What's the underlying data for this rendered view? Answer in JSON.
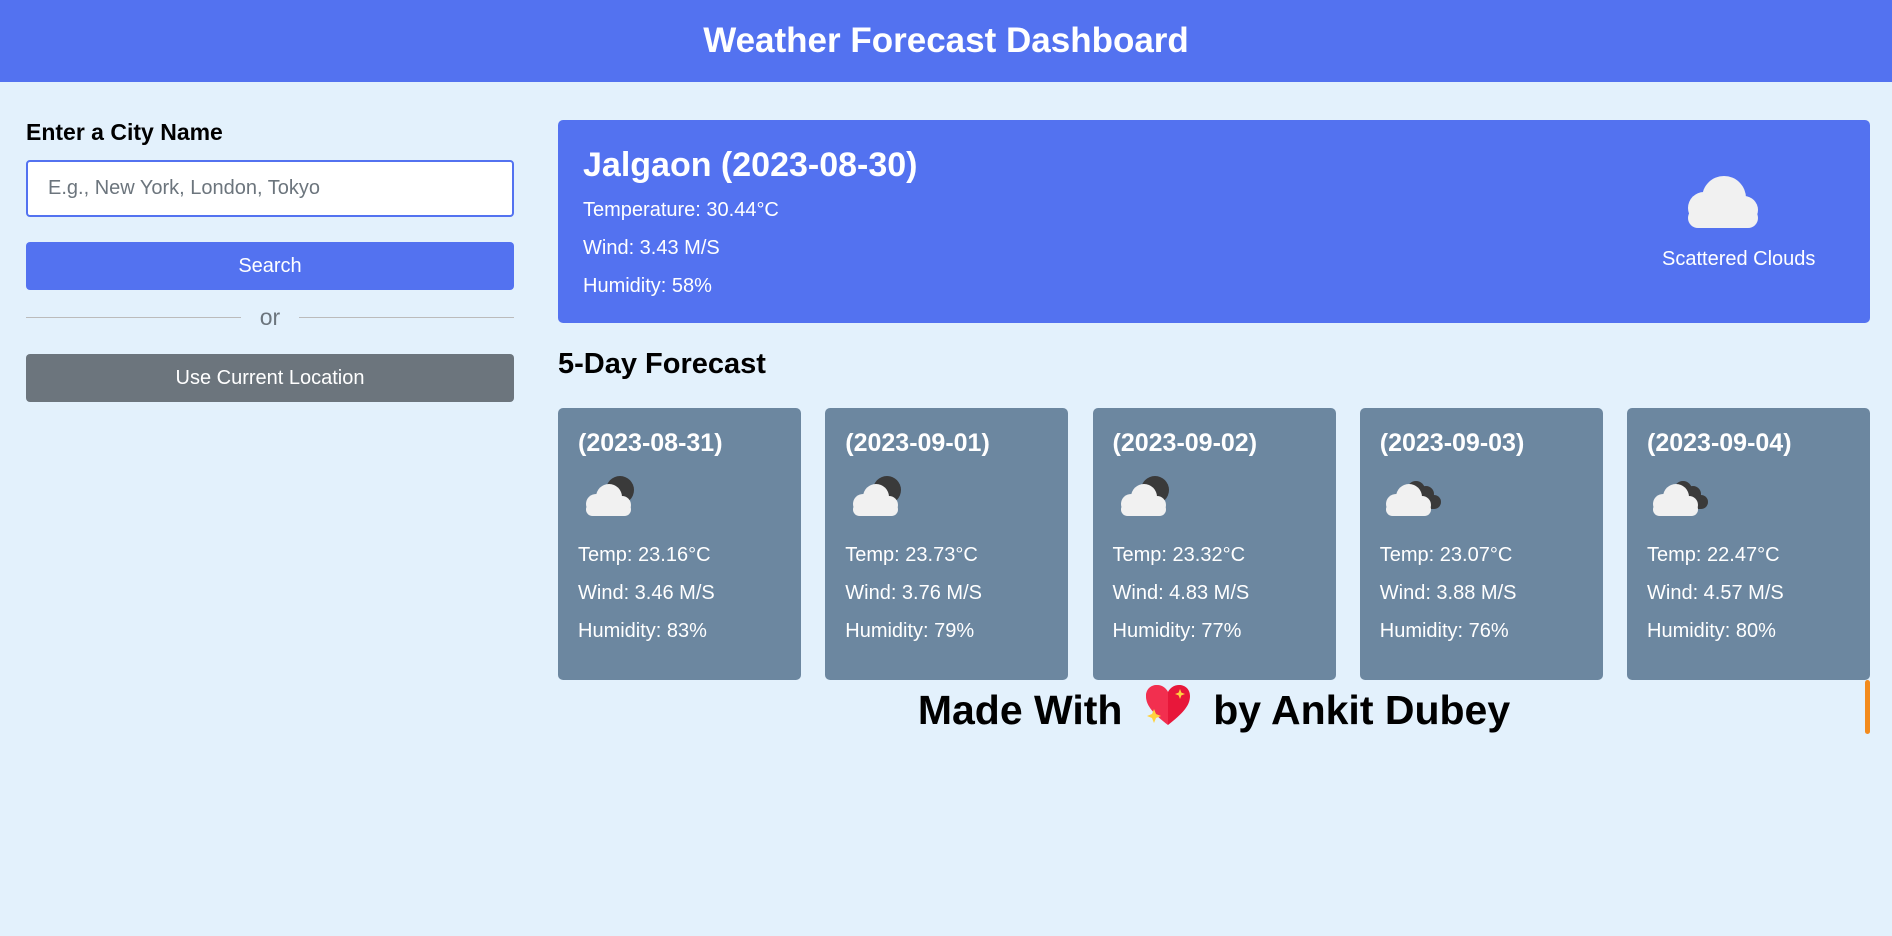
{
  "header": {
    "title": "Weather Forecast Dashboard"
  },
  "sidebar": {
    "label": "Enter a City Name",
    "input": {
      "value": "",
      "placeholder": "E.g., New York, London, Tokyo"
    },
    "search_label": "Search",
    "separator_text": "or",
    "location_label": "Use Current Location"
  },
  "current": {
    "title": "Jalgaon (2023-08-30)",
    "temperature": "Temperature: 30.44°C",
    "wind": "Wind: 3.43 M/S",
    "humidity": "Humidity: 58%",
    "icon": "scattered-clouds-icon",
    "description": "Scattered Clouds"
  },
  "forecast": {
    "title": "5-Day Forecast",
    "days": [
      {
        "date": "(2023-08-31)",
        "icon": "cloud-sun-icon",
        "temp": "Temp: 23.16°C",
        "wind": "Wind: 3.46 M/S",
        "humidity": "Humidity: 83%"
      },
      {
        "date": "(2023-09-01)",
        "icon": "cloud-sun-icon",
        "temp": "Temp: 23.73°C",
        "wind": "Wind: 3.76 M/S",
        "humidity": "Humidity: 79%"
      },
      {
        "date": "(2023-09-02)",
        "icon": "cloud-sun-icon",
        "temp": "Temp: 23.32°C",
        "wind": "Wind: 4.83 M/S",
        "humidity": "Humidity: 77%"
      },
      {
        "date": "(2023-09-03)",
        "icon": "broken-clouds-icon",
        "temp": "Temp: 23.07°C",
        "wind": "Wind: 3.88 M/S",
        "humidity": "Humidity: 76%"
      },
      {
        "date": "(2023-09-04)",
        "icon": "broken-clouds-icon",
        "temp": "Temp: 22.47°C",
        "wind": "Wind: 4.57 M/S",
        "humidity": "Humidity: 80%"
      }
    ]
  },
  "footer": {
    "prefix": "Made With",
    "suffix": "by Ankit Dubey",
    "icon": "sparkling-heart-icon"
  },
  "colors": {
    "primary": "#5372f0",
    "background": "#e3f1fc",
    "card": "#6c87a0",
    "secondary_button": "#6c757d",
    "accent": "#f38b1d"
  }
}
